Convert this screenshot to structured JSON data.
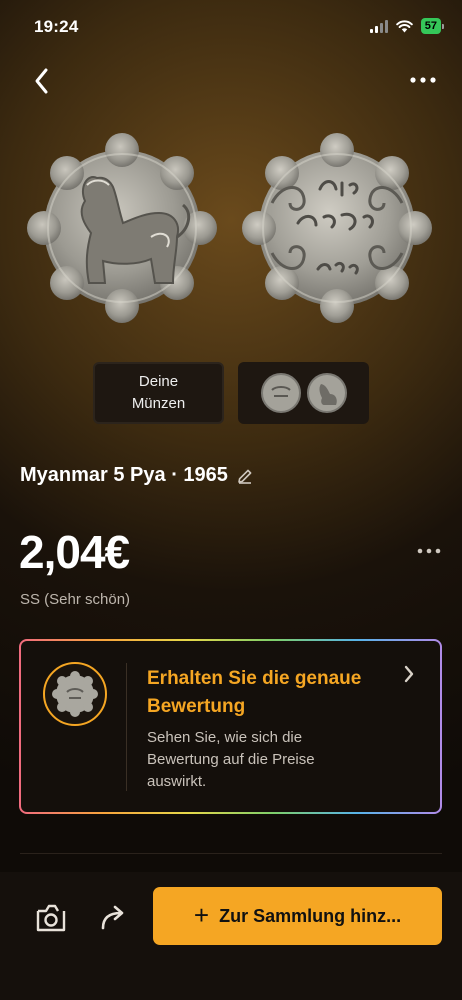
{
  "status_bar": {
    "time": "19:24",
    "battery": "57"
  },
  "coin": {
    "tile_label": "Deine Münzen",
    "title": "Myanmar 5 Pya · 1965",
    "price": "2,04€",
    "grade": "SS (Sehr schön)"
  },
  "valuation_card": {
    "heading": "Erhalten Sie die genaue Bewertung",
    "text": "Sehen Sie, wie sich die Bewertung auf die Preise auswirkt."
  },
  "bottom_bar": {
    "add_label": "Zur Sammlung hinz..."
  },
  "colors": {
    "accent": "#f5a623",
    "background": "#0f0b07"
  }
}
